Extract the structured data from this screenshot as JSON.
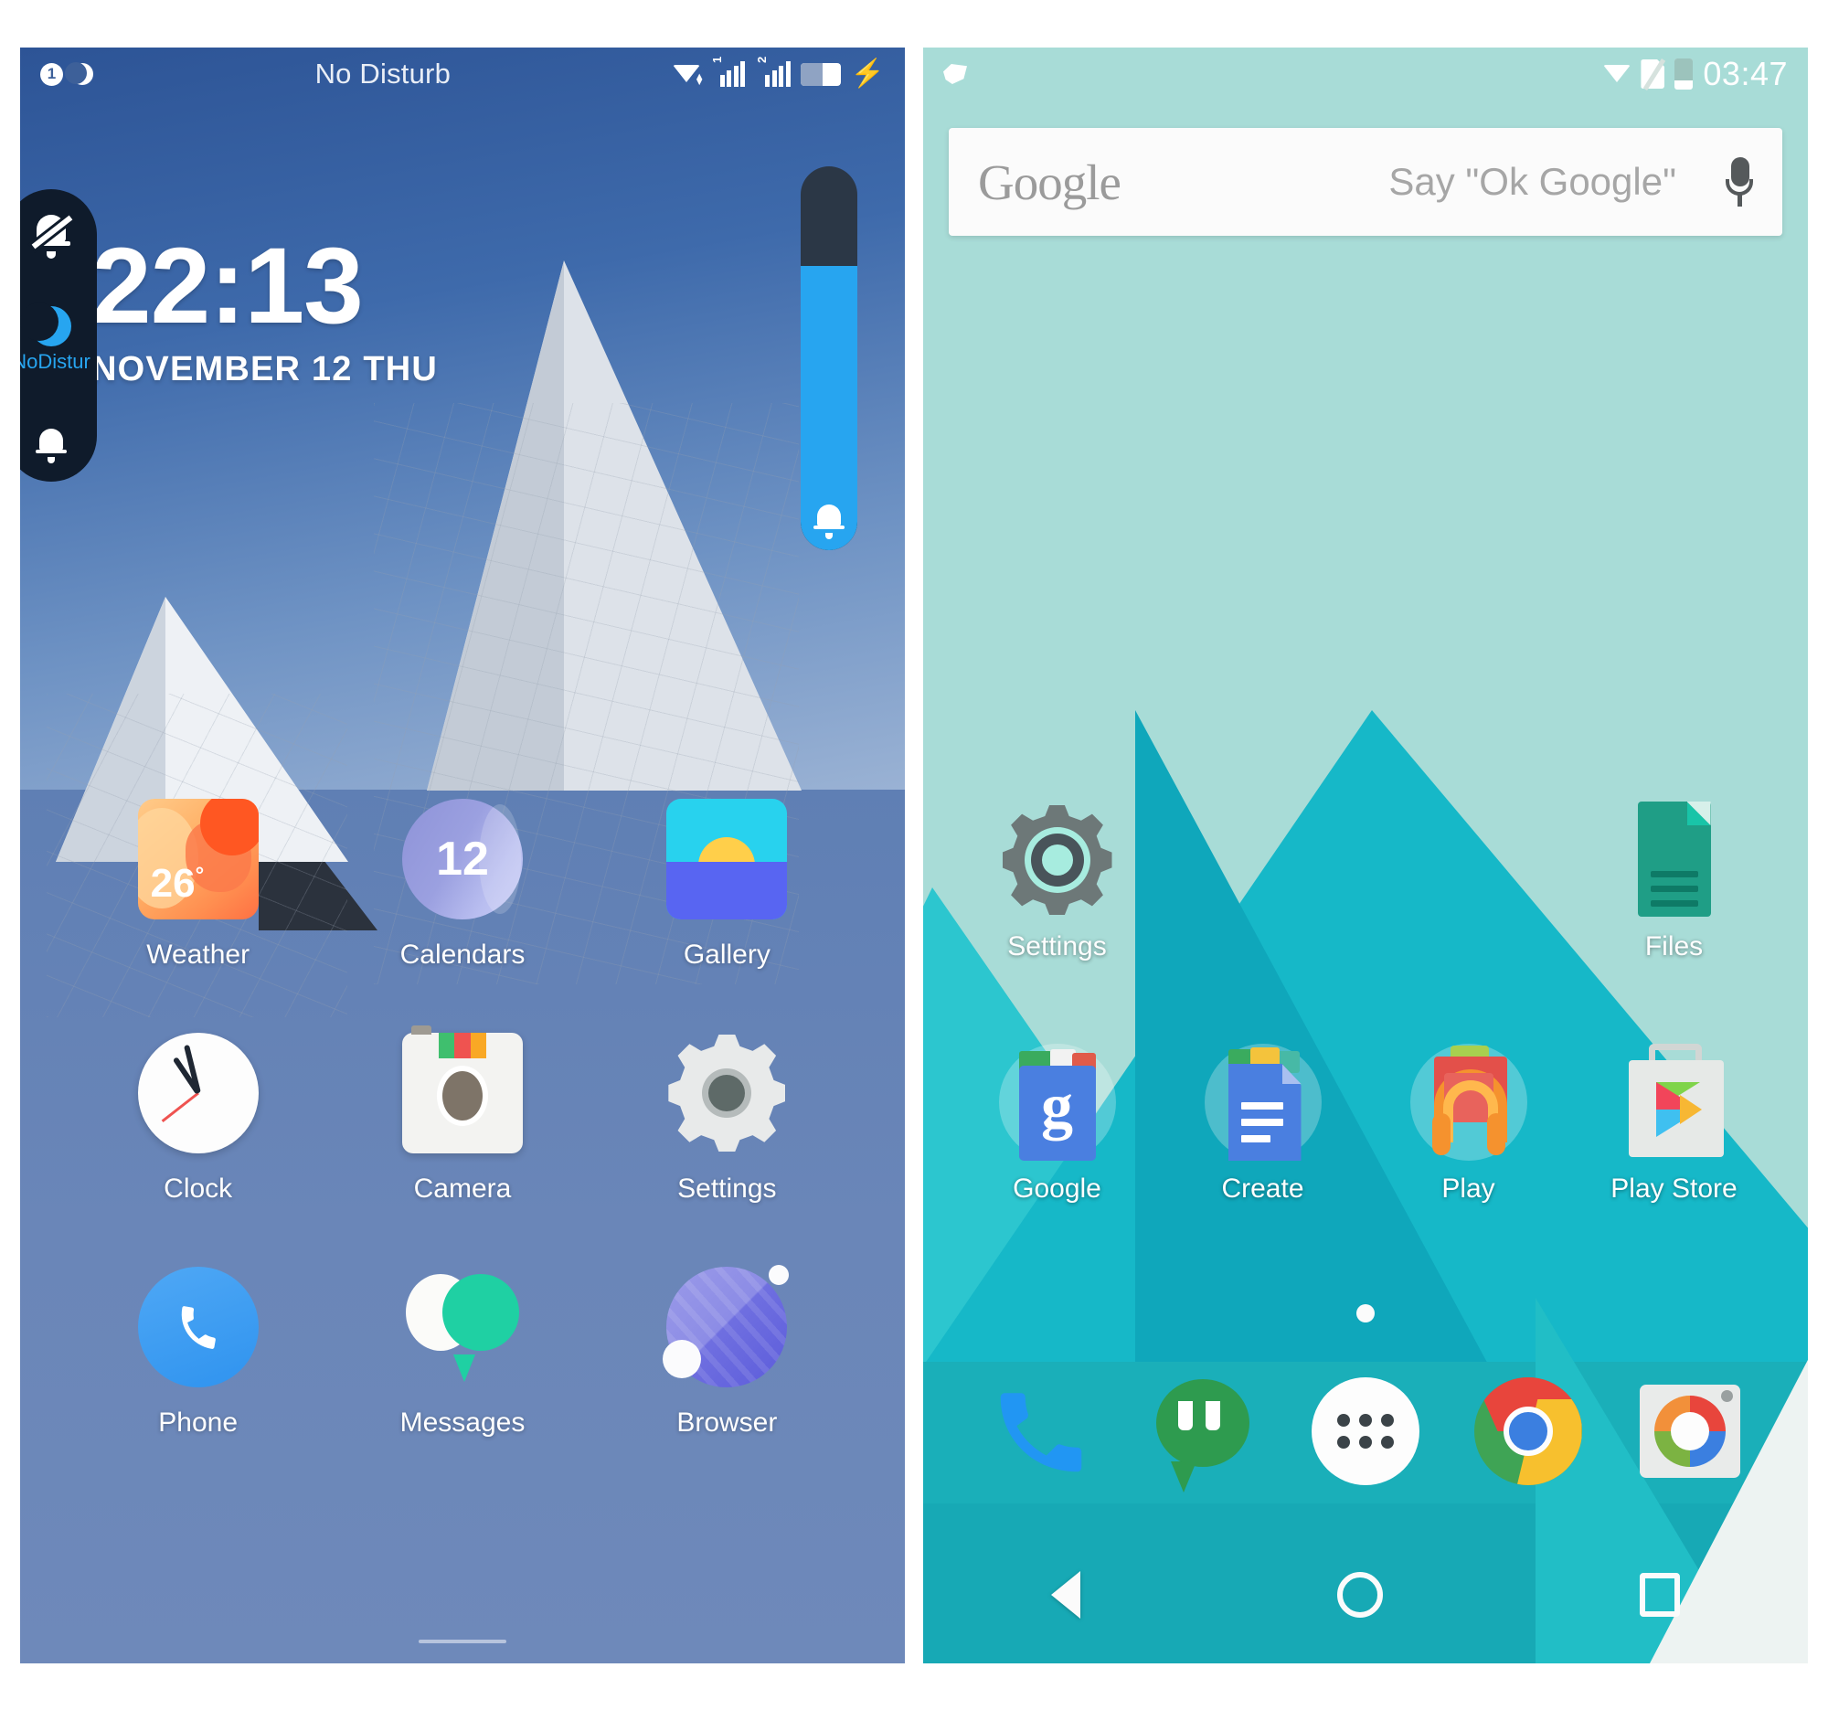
{
  "left_phone": {
    "status_bar": {
      "notification_count": "1",
      "dnd_moon_icon": "moon-icon",
      "center_text": "No Disturb",
      "wifi_icon": "wifi-icon",
      "sim1_label": "1",
      "sim2_label": "2",
      "battery_icon": "battery-icon",
      "charging_icon": "charging-bolt-icon"
    },
    "dnd_panel": {
      "mute_icon": "bell-off-icon",
      "dnd_icon": "moon-icon",
      "dnd_label": "NoDistur",
      "ring_icon": "bell-icon",
      "accent_color": "#27a5f0",
      "panel_color": "#0f1b2b"
    },
    "volume_slider": {
      "level_percent": 74,
      "fill_color": "#27a5f0",
      "track_color": "#2b3746",
      "bell_icon": "bell-icon"
    },
    "clock_widget": {
      "time": "22:13",
      "date": "NOVEMBER 12  THU"
    },
    "apps": [
      {
        "label": "Weather",
        "icon": "weather-icon",
        "temp": "26",
        "degree": "°"
      },
      {
        "label": "Calendars",
        "icon": "calendar-icon",
        "day": "12"
      },
      {
        "label": "Gallery",
        "icon": "gallery-icon"
      },
      {
        "label": "Clock",
        "icon": "clock-icon"
      },
      {
        "label": "Camera",
        "icon": "camera-icon"
      },
      {
        "label": "Settings",
        "icon": "gear-icon"
      },
      {
        "label": "Phone",
        "icon": "phone-icon"
      },
      {
        "label": "Messages",
        "icon": "messages-icon"
      },
      {
        "label": "Browser",
        "icon": "browser-icon"
      }
    ]
  },
  "right_phone": {
    "status_bar": {
      "notification_icon": "notification-icon",
      "wifi_icon": "wifi-icon",
      "nosim_icon": "no-sim-icon",
      "battery_icon": "battery-icon",
      "time": "03:47"
    },
    "search_bar": {
      "logo": "Google",
      "placeholder": "Say \"Ok Google\"",
      "mic_icon": "microphone-icon"
    },
    "apps_row1": [
      {
        "label": "Settings",
        "icon": "gear-icon"
      },
      {
        "label": "Files",
        "icon": "document-icon"
      }
    ],
    "apps_row2": [
      {
        "label": "Google",
        "icon": "google-folder-icon"
      },
      {
        "label": "Create",
        "icon": "create-folder-icon"
      },
      {
        "label": "Play",
        "icon": "play-folder-icon"
      },
      {
        "label": "Play Store",
        "icon": "play-store-icon"
      }
    ],
    "page_indicator": {
      "pages": 1,
      "current": 1
    },
    "dock": [
      {
        "label": "Phone",
        "icon": "phone-icon"
      },
      {
        "label": "Hangouts",
        "icon": "hangouts-icon"
      },
      {
        "label": "App Drawer",
        "icon": "app-drawer-icon"
      },
      {
        "label": "Chrome",
        "icon": "chrome-icon"
      },
      {
        "label": "Camera",
        "icon": "camera-icon"
      }
    ],
    "nav_bar": [
      {
        "label": "Back",
        "icon": "back-triangle-icon"
      },
      {
        "label": "Home",
        "icon": "home-circle-icon"
      },
      {
        "label": "Recents",
        "icon": "recents-square-icon"
      }
    ]
  }
}
